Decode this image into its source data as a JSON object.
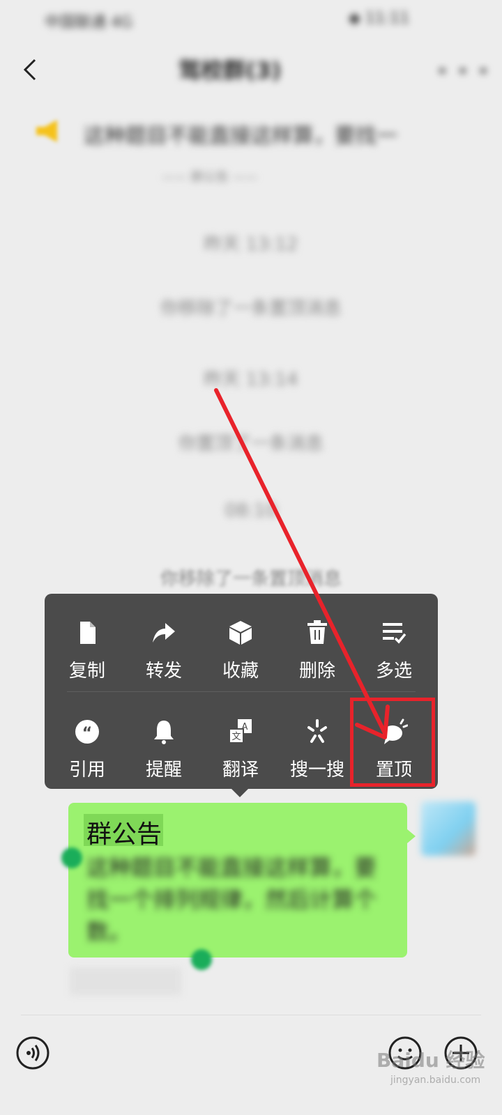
{
  "status_bar": {
    "left": "中国联通 4G",
    "right": "◆ 11:11"
  },
  "header": {
    "title": "驾校群(3)",
    "more_icon": "more-icon",
    "back_icon": "back-icon"
  },
  "pinned": {
    "text": "这种题目不能直接这样算，要找一",
    "sub": "—— 群公告 ——"
  },
  "system_messages": [
    {
      "text": "昨天 13:12"
    },
    {
      "text": "你移除了一条置顶消息"
    },
    {
      "text": "昨天 13:14"
    },
    {
      "text": "你置顶了一条消息"
    },
    {
      "text": "08:10"
    },
    {
      "text": "你移除了一条置顶消息"
    }
  ],
  "menu": {
    "row1": [
      {
        "label": "复制",
        "icon": "copy-icon"
      },
      {
        "label": "转发",
        "icon": "forward-icon"
      },
      {
        "label": "收藏",
        "icon": "favorite-icon"
      },
      {
        "label": "删除",
        "icon": "delete-icon"
      },
      {
        "label": "多选",
        "icon": "multiselect-icon"
      }
    ],
    "row2": [
      {
        "label": "引用",
        "icon": "quote-icon"
      },
      {
        "label": "提醒",
        "icon": "bell-icon"
      },
      {
        "label": "翻译",
        "icon": "translate-icon"
      },
      {
        "label": "搜一搜",
        "icon": "search-icon"
      },
      {
        "label": "置顶",
        "icon": "pin-top-icon"
      }
    ]
  },
  "message": {
    "title": "群公告",
    "body": "这种题目不能直接这样算，要找一个排列规律，然后计算个数。"
  },
  "watermark": {
    "text": "Baidu 经验",
    "sub": "jingyan.baidu.com"
  },
  "colors": {
    "menu_bg": "#4b4b4b",
    "bubble": "#9bf26f",
    "annotation": "#e8232b",
    "background": "#ededed"
  }
}
